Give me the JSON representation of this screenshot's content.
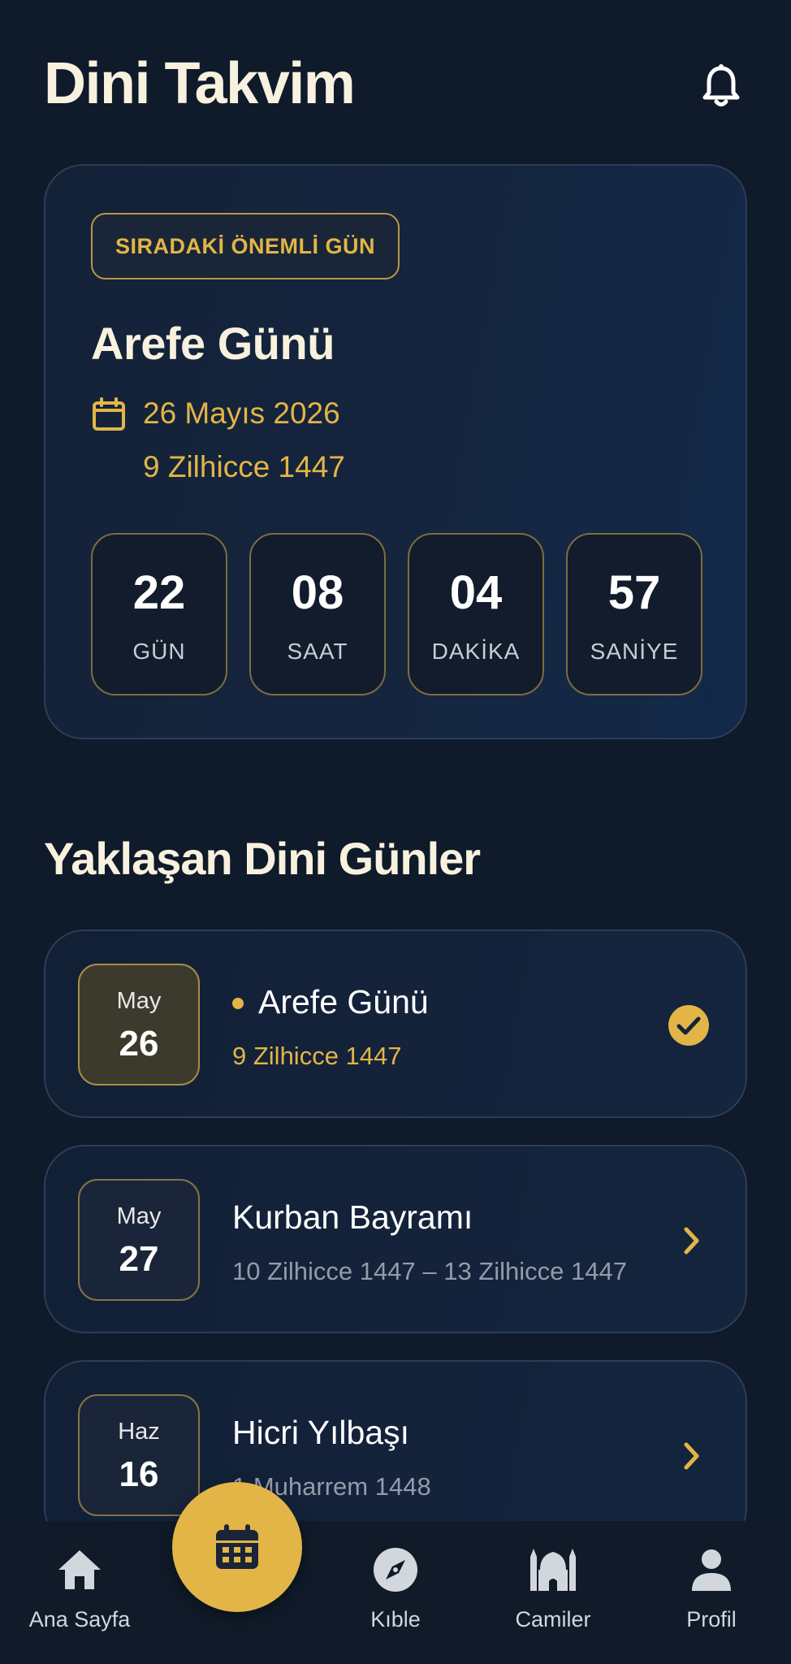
{
  "header": {
    "title": "Dini Takvim",
    "bell_icon": "bell-icon"
  },
  "featured": {
    "badge": "SIRADAKİ ÖNEMLİ GÜN",
    "title": "Arefe Günü",
    "date": "26 Mayıs 2026",
    "hijri": "9 Zilhicce 1447",
    "countdown": [
      {
        "value": "22",
        "label": "GÜN"
      },
      {
        "value": "08",
        "label": "SAAT"
      },
      {
        "value": "04",
        "label": "DAKİKA"
      },
      {
        "value": "57",
        "label": "SANİYE"
      }
    ]
  },
  "section_title": "Yaklaşan Dini Günler",
  "events": [
    {
      "month": "May",
      "day": "26",
      "title": "Arefe Günü",
      "subtitle": "9 Zilhicce 1447",
      "state": "current"
    },
    {
      "month": "May",
      "day": "27",
      "title": "Kurban Bayramı",
      "subtitle": "10 Zilhicce 1447 – 13 Zilhicce 1447",
      "state": "upcoming"
    },
    {
      "month": "Haz",
      "day": "16",
      "title": "Hicri Yılbaşı",
      "subtitle": "1 Muharrem 1448",
      "state": "upcoming"
    }
  ],
  "nav": {
    "items": [
      {
        "label": "Ana Sayfa",
        "icon": "home-icon"
      },
      {
        "label": "Kıble",
        "icon": "compass-icon"
      },
      {
        "label": "Camiler",
        "icon": "mosque-icon"
      },
      {
        "label": "Profil",
        "icon": "person-icon"
      }
    ],
    "center_icon": "calendar-icon"
  },
  "colors": {
    "background": "#0f1a2a",
    "accent": "#e2b546",
    "card": "#15253e",
    "text": "#f7f1de"
  }
}
